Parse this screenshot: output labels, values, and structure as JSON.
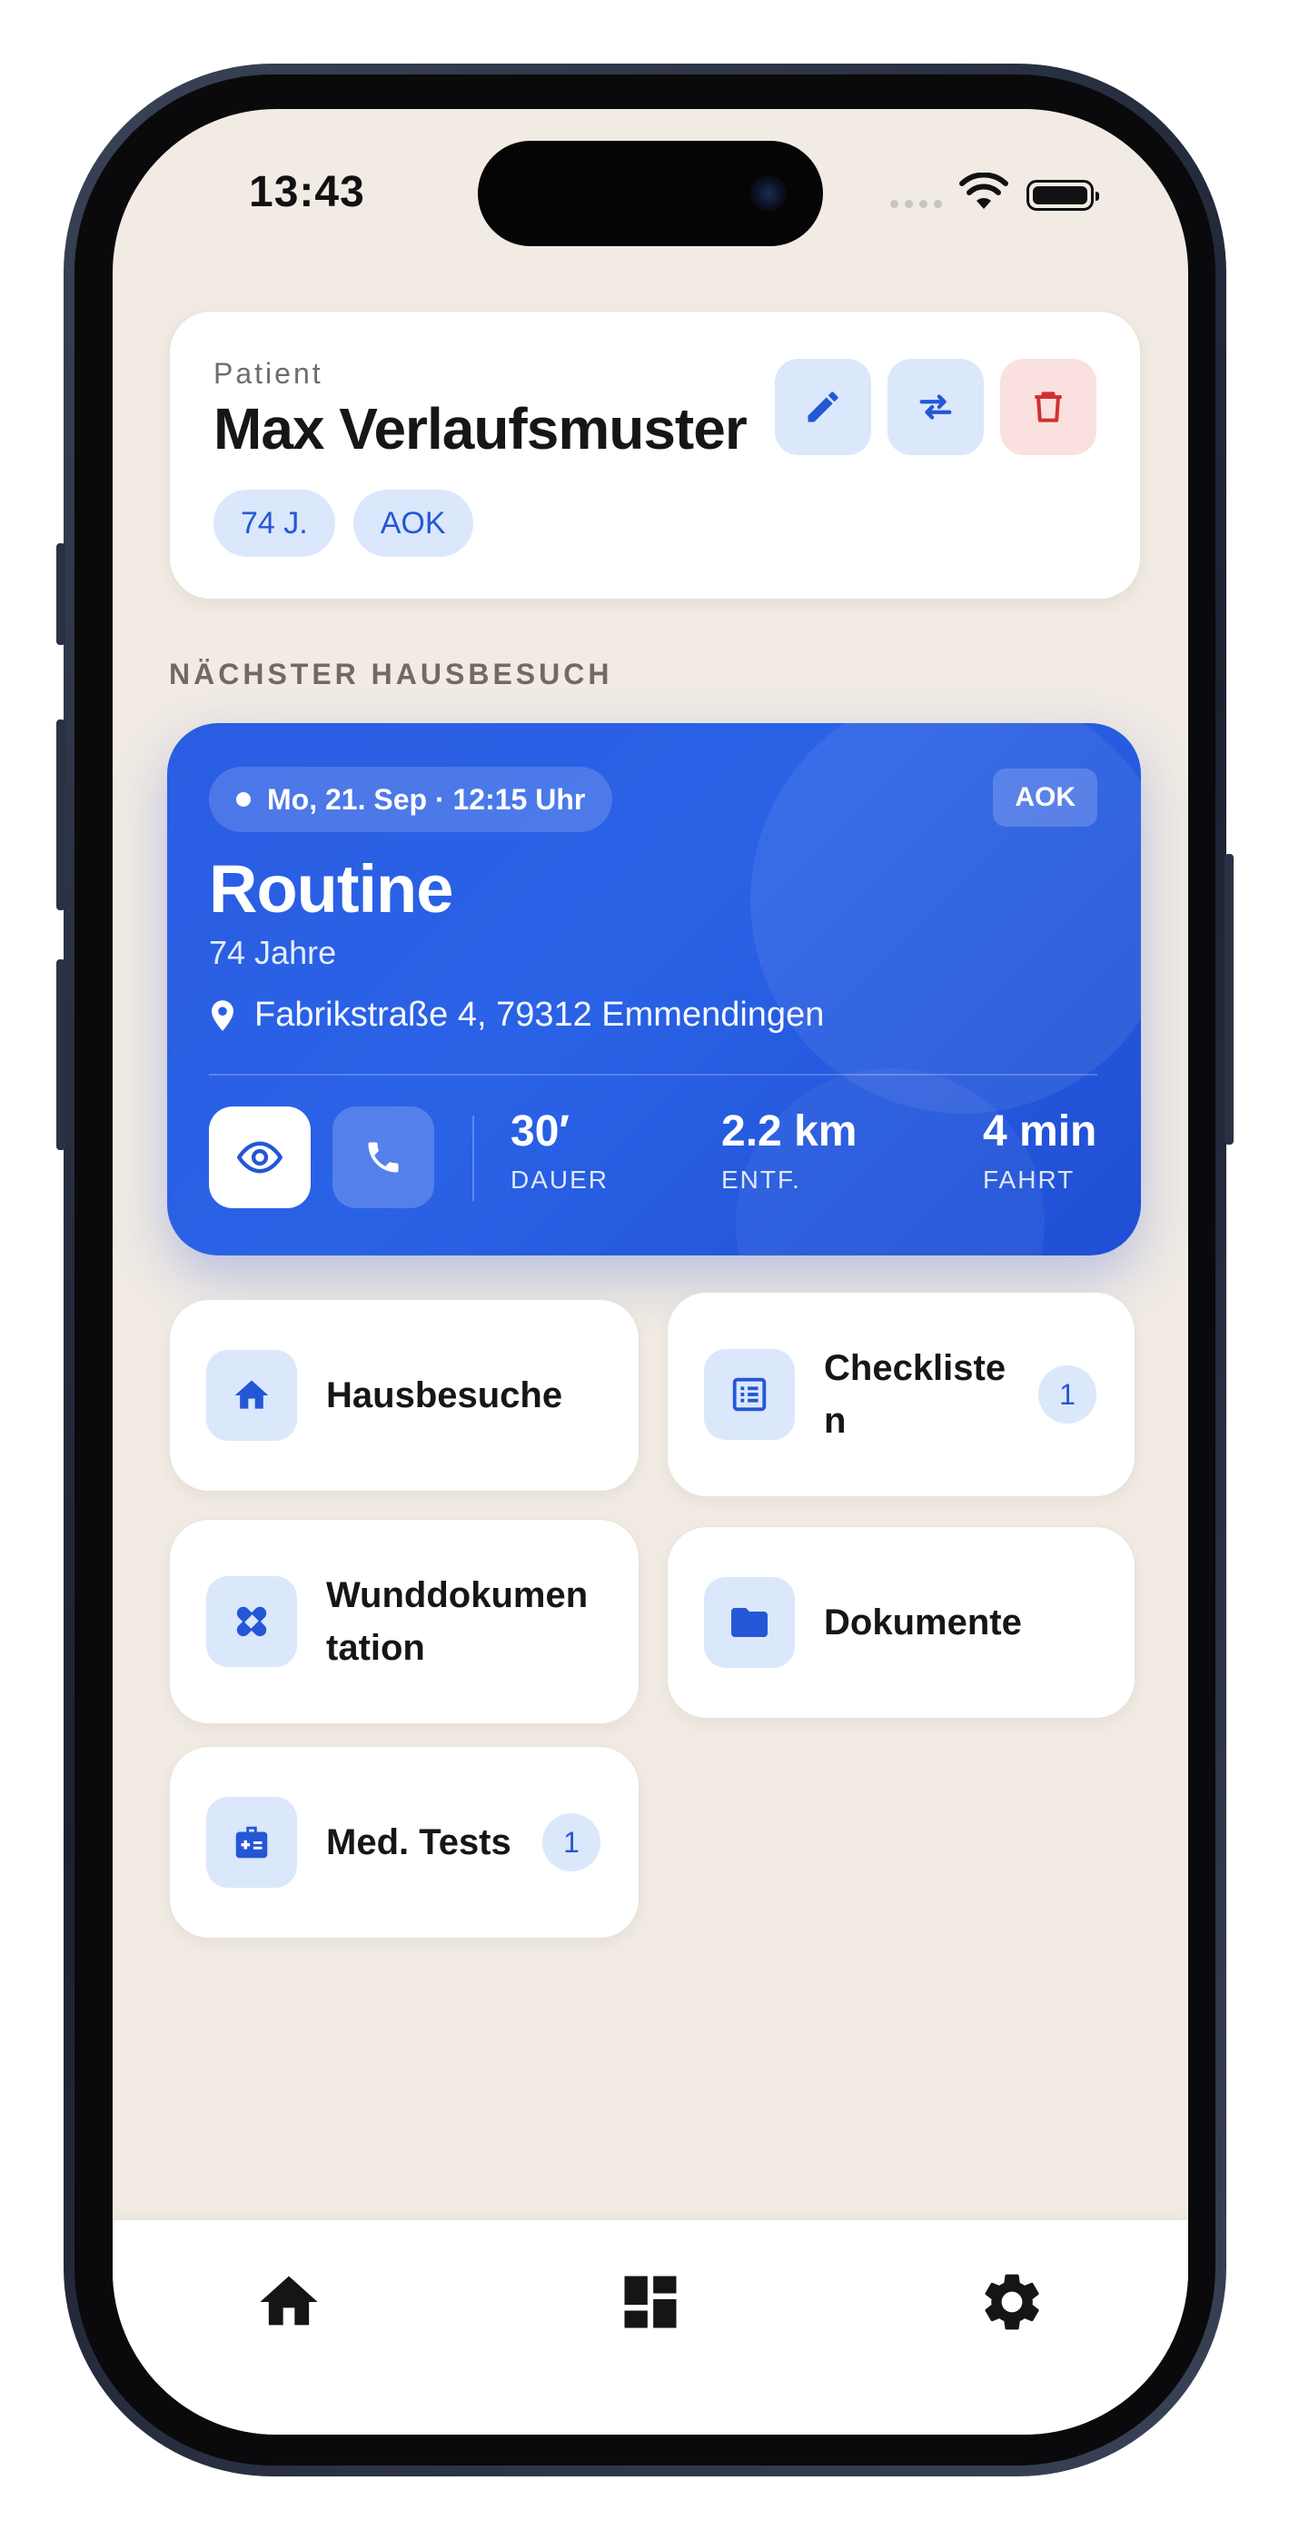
{
  "status_bar": {
    "time": "13:43"
  },
  "patient": {
    "label": "Patient",
    "name": "Max Verlaufsmuster",
    "chips": [
      "74 J.",
      "AOK"
    ],
    "actions": [
      "pencil-icon",
      "swap-icon",
      "trash-icon"
    ]
  },
  "next_visit": {
    "section_label": "NÄCHSTER HAUSBESUCH",
    "date": "Mo, 21. Sep · 12:15 Uhr",
    "insurance": "AOK",
    "title": "Routine",
    "age": "74 Jahre",
    "address": "Fabrikstraße 4, 79312 Emmendingen",
    "stats": [
      {
        "value": "30′",
        "label": "DAUER"
      },
      {
        "value": "2.2 km",
        "label": "ENTF."
      },
      {
        "value": "4 min",
        "label": "FAHRT"
      }
    ]
  },
  "tiles": [
    {
      "label": "Hausbesuche",
      "icon": "home-icon",
      "badge": ""
    },
    {
      "label": "Checkliste\nn",
      "icon": "checklist-icon",
      "badge": "1"
    },
    {
      "label": "Wunddokumen\ntation",
      "icon": "bandage-icon",
      "badge": ""
    },
    {
      "label": "Dokumente",
      "icon": "folder-icon",
      "badge": ""
    },
    {
      "label": "Med. Tests",
      "icon": "medical-kit-icon",
      "badge": "1"
    }
  ],
  "tabbar": [
    "home-icon",
    "dashboard-icon",
    "gear-icon"
  ],
  "colors": {
    "accent": "#2a5de3",
    "tile_icon_bg": "#dbe7fb",
    "danger": "#d32f2f",
    "background": "#f1ebe4"
  }
}
